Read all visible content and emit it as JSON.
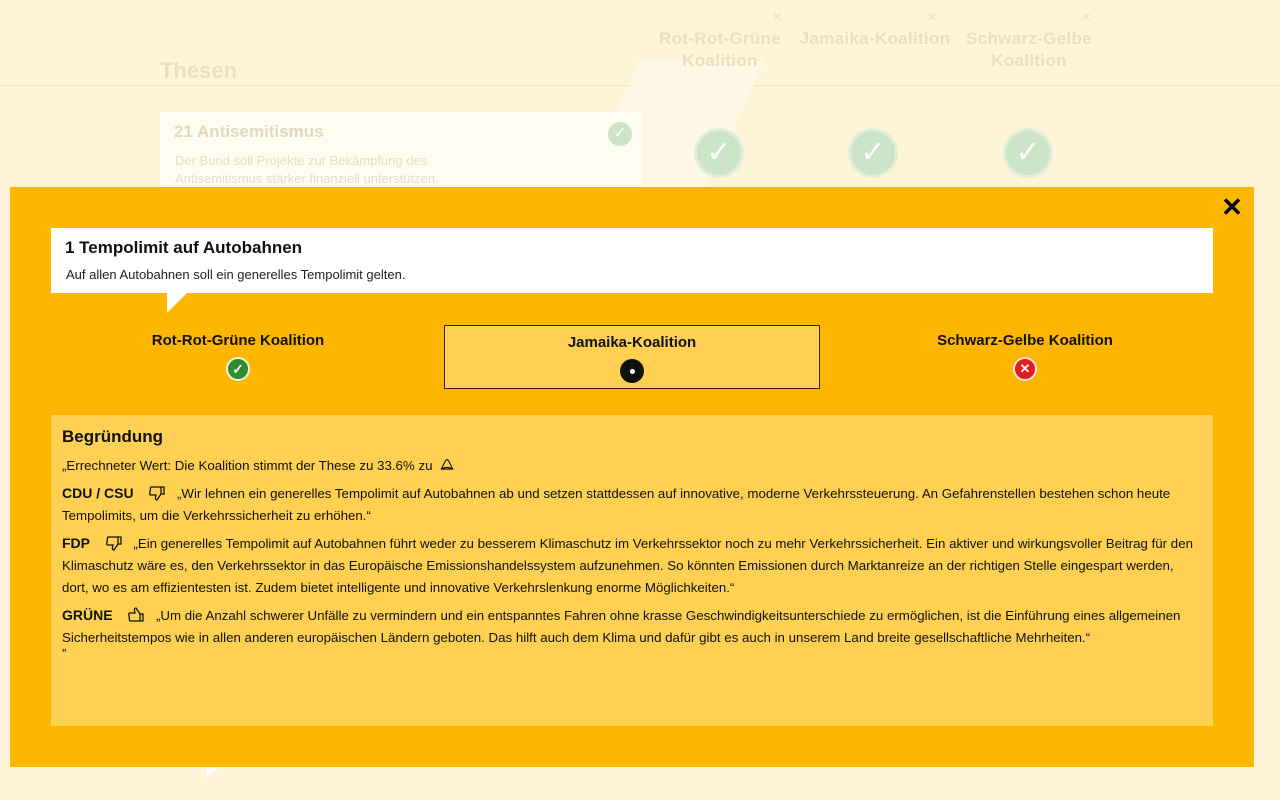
{
  "background": {
    "page_title": "Thesen",
    "columns": [
      {
        "name": "Rot-Rot-Grüne Koalition",
        "close": "×"
      },
      {
        "name": "Jamaika-Koalition",
        "close": "×"
      },
      {
        "name": "Schwarz-Gelbe Koalition",
        "close": "×"
      }
    ],
    "card": {
      "title": "21 Antisemitismus",
      "text": "Der Bund soll Projekte zur Bekämpfung des Antisemitismus stärker finanziell unterstützen.",
      "check": "✓"
    },
    "big_checks": [
      "✓",
      "✓",
      "✓"
    ]
  },
  "modal": {
    "close": "✕",
    "thesis": {
      "title": "1 Tempolimit auf Autobahnen",
      "text": "Auf allen Autobahnen soll ein generelles Tempolimit gelten."
    },
    "coalitions": [
      {
        "name": "Rot-Rot-Grüne Koalition",
        "status": "yes",
        "symbol": "✓",
        "selected": false
      },
      {
        "name": "Jamaika-Koalition",
        "status": "neutral",
        "symbol": "",
        "selected": true
      },
      {
        "name": "Schwarz-Gelbe Koalition",
        "status": "no",
        "symbol": "✕",
        "selected": false
      }
    ],
    "reasoning": {
      "title": "Begründung",
      "computed": "„Errechneter Wert: Die Koalition stimmt der These zu 33.6% zu",
      "statements": [
        {
          "party": "CDU / CSU",
          "vote": "thumbs-down",
          "text": "„Wir lehnen ein generelles Tempolimit auf Autobahnen ab und setzen stattdessen auf innovative, moderne Verkehrssteuerung. An Gefahrenstellen bestehen schon heute Tempolimits, um die Verkehrssicherheit zu erhöhen.“"
        },
        {
          "party": "FDP",
          "vote": "thumbs-down",
          "text": "„Ein generelles Tempolimit auf Autobahnen führt weder zu besserem Klimaschutz im Verkehrssektor noch zu mehr Verkehrssicherheit. Ein aktiver und wirkungsvoller Beitrag für den Klimaschutz wäre es, den Verkehrssektor in das Europäische Emissionshandelssystem aufzunehmen. So könnten Emissionen durch Marktanreize an der richtigen Stelle eingespart werden, dort, wo es am effizientesten ist. Zudem bietet intelligente und innovative Verkehrslenkung enorme Möglichkeiten.“"
        },
        {
          "party": "GRÜNE",
          "vote": "thumbs-up",
          "text": "„Um die Anzahl schwerer Unfälle zu vermindern und ein entspanntes Fahren ohne krasse Geschwindigkeitsunterschiede zu ermöglichen, ist die Einführung eines allgemeinen Sicherheitstempos wie in allen anderen europäischen Ländern geboten. Das hilft auch dem Klima und dafür gibt es auch in unserem Land breite gesellschaftliche Mehrheiten.“"
        }
      ],
      "closing_quote": "”"
    }
  },
  "colors": {
    "page_bg": "#FEF4D8",
    "modal_bg": "#FFB600",
    "panel_bg": "#FFD051",
    "yes": "#2E8B2E",
    "no": "#E31C1C"
  }
}
